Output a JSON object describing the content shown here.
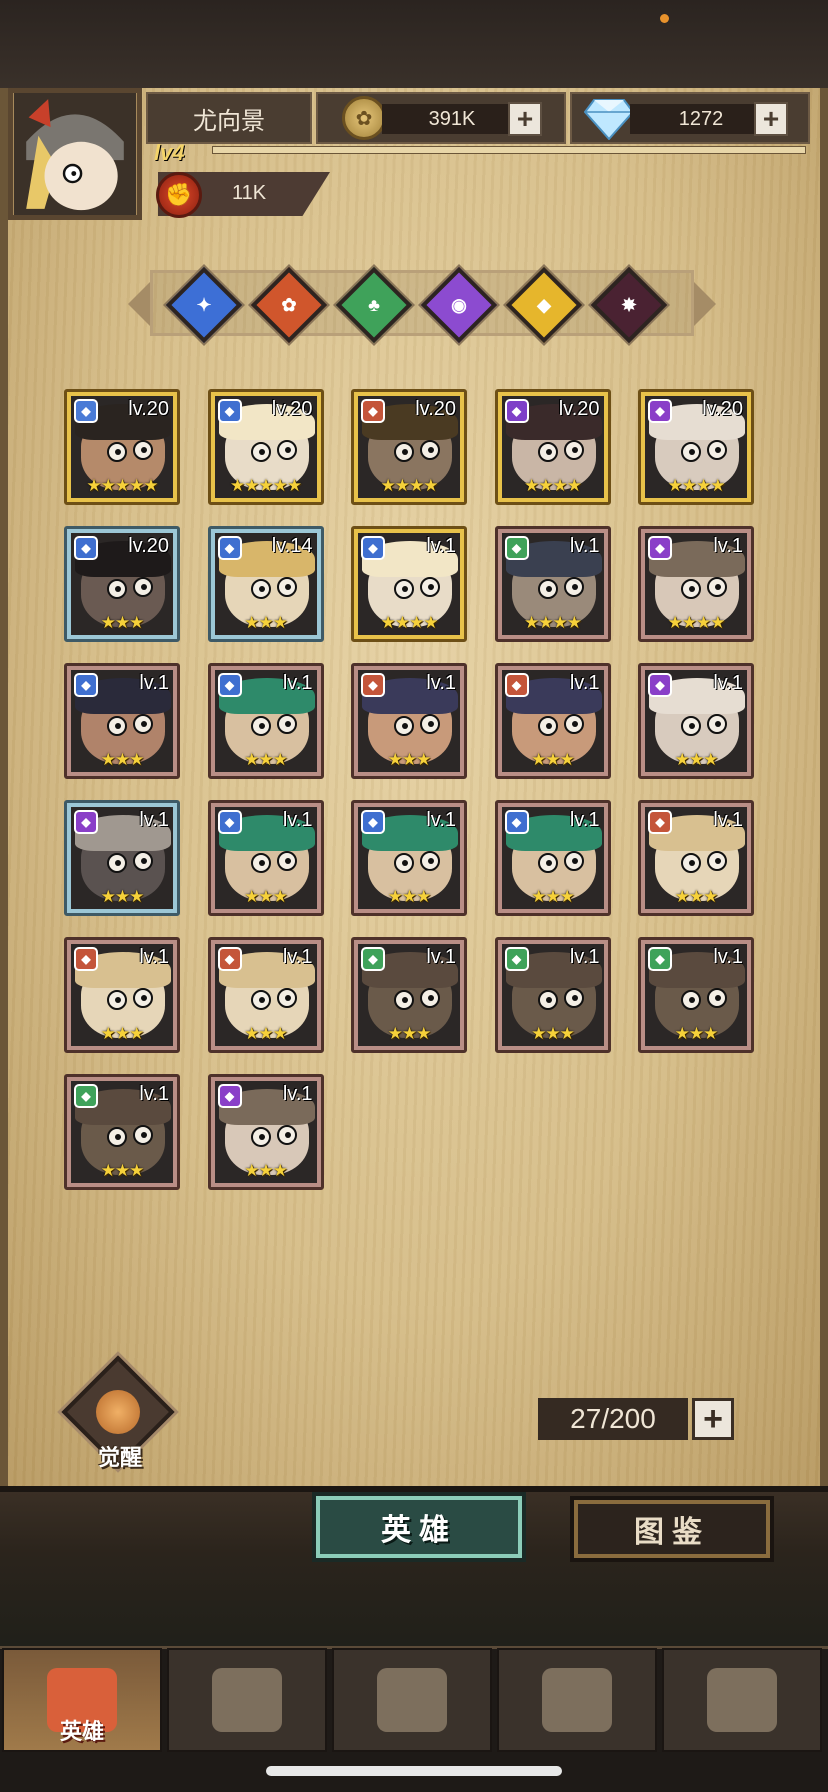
{
  "player": {
    "name": "尤向景",
    "level": "lv4",
    "power": "11K"
  },
  "resources": {
    "gold": "391K",
    "gems": "1272",
    "plus": "+"
  },
  "elements": [
    {
      "name": "blue-faction",
      "color": "#3d6fd6",
      "glyph": "✦"
    },
    {
      "name": "orange-faction",
      "color": "#d0562c",
      "glyph": "✿"
    },
    {
      "name": "green-faction",
      "color": "#3fa25a",
      "glyph": "♣"
    },
    {
      "name": "purple-faction",
      "color": "#8c4bd0",
      "glyph": "◉"
    },
    {
      "name": "gold-faction",
      "color": "#e6b62c",
      "glyph": "◆"
    },
    {
      "name": "dark-faction",
      "color": "#4a2232",
      "glyph": "✸"
    }
  ],
  "heroes": [
    {
      "lv": "lv.20",
      "stars": "★★★★★",
      "frame": "gold",
      "cls": "#4a7bd6",
      "skin": "#b58a6a",
      "hair": "#2a2420"
    },
    {
      "lv": "lv.20",
      "stars": "★★★★★",
      "frame": "gold",
      "cls": "#3f6fd0",
      "skin": "#e8dcc8",
      "hair": "#f2e6c6"
    },
    {
      "lv": "lv.20",
      "stars": "★★★★",
      "frame": "gold",
      "cls": "#c4553a",
      "skin": "#8a7560",
      "hair": "#4a3a22"
    },
    {
      "lv": "lv.20",
      "stars": "★★★★",
      "frame": "gold",
      "cls": "#7e3fc8",
      "skin": "#c9b6a6",
      "hair": "#3a2a2a"
    },
    {
      "lv": "lv.20",
      "stars": "★★★★",
      "frame": "gold",
      "cls": "#8a3fc8",
      "skin": "#d8cbbe",
      "hair": "#e6ddd2"
    },
    {
      "lv": "lv.20",
      "stars": "★★★",
      "frame": "blue",
      "cls": "#3f6fd0",
      "skin": "#6a5a52",
      "hair": "#1e1a1a"
    },
    {
      "lv": "lv.14",
      "stars": "★★★",
      "frame": "blue",
      "cls": "#3f6fd0",
      "skin": "#e6d6b8",
      "hair": "#d8b66a"
    },
    {
      "lv": "lv.1",
      "stars": "★★★★",
      "frame": "gold",
      "cls": "#3f6fd0",
      "skin": "#e8dcc8",
      "hair": "#f2e6c6"
    },
    {
      "lv": "lv.1",
      "stars": "★★★★",
      "frame": "brown",
      "cls": "#3fa25a",
      "skin": "#9a8a7a",
      "hair": "#3a4050"
    },
    {
      "lv": "lv.1",
      "stars": "★★★★",
      "frame": "brown",
      "cls": "#8a3fc8",
      "skin": "#d8c8b8",
      "hair": "#7a6a5a"
    },
    {
      "lv": "lv.1",
      "stars": "★★★",
      "frame": "brown",
      "cls": "#3f6fd0",
      "skin": "#b0836a",
      "hair": "#2a2a3a"
    },
    {
      "lv": "lv.1",
      "stars": "★★★",
      "frame": "brown",
      "cls": "#3f6fd0",
      "skin": "#d8c0a0",
      "hair": "#2e8a6a"
    },
    {
      "lv": "lv.1",
      "stars": "★★★",
      "frame": "brown",
      "cls": "#c4553a",
      "skin": "#c89a7a",
      "hair": "#3a3a5a"
    },
    {
      "lv": "lv.1",
      "stars": "★★★",
      "frame": "brown",
      "cls": "#c4553a",
      "skin": "#c89a7a",
      "hair": "#3a3a5a"
    },
    {
      "lv": "lv.1",
      "stars": "★★★",
      "frame": "brown",
      "cls": "#8a3fc8",
      "skin": "#d8cbbe",
      "hair": "#e6ddd2"
    },
    {
      "lv": "lv.1",
      "stars": "★★★",
      "frame": "blue",
      "cls": "#8a3fc8",
      "skin": "#5a5250",
      "hair": "#a09890"
    },
    {
      "lv": "lv.1",
      "stars": "★★★",
      "frame": "brown",
      "cls": "#3f6fd0",
      "skin": "#d8c0a0",
      "hair": "#2e8a6a"
    },
    {
      "lv": "lv.1",
      "stars": "★★★",
      "frame": "brown",
      "cls": "#3f6fd0",
      "skin": "#d8c0a0",
      "hair": "#2e8a6a"
    },
    {
      "lv": "lv.1",
      "stars": "★★★",
      "frame": "brown",
      "cls": "#3f6fd0",
      "skin": "#d8c0a0",
      "hair": "#2e8a6a"
    },
    {
      "lv": "lv.1",
      "stars": "★★★",
      "frame": "brown",
      "cls": "#c4553a",
      "skin": "#e6d6b8",
      "hair": "#d8c090"
    },
    {
      "lv": "lv.1",
      "stars": "★★★",
      "frame": "brown",
      "cls": "#c4553a",
      "skin": "#e6d6b8",
      "hair": "#d8c090"
    },
    {
      "lv": "lv.1",
      "stars": "★★★",
      "frame": "brown",
      "cls": "#c4553a",
      "skin": "#e6d6b8",
      "hair": "#d8c090"
    },
    {
      "lv": "lv.1",
      "stars": "★★★",
      "frame": "brown",
      "cls": "#3fa25a",
      "skin": "#6a5a4a",
      "hair": "#5a4a3e"
    },
    {
      "lv": "lv.1",
      "stars": "★★★",
      "frame": "brown",
      "cls": "#3fa25a",
      "skin": "#6a5a4a",
      "hair": "#5a4a3e"
    },
    {
      "lv": "lv.1",
      "stars": "★★★",
      "frame": "brown",
      "cls": "#3fa25a",
      "skin": "#6a5a4a",
      "hair": "#5a4a3e"
    },
    {
      "lv": "lv.1",
      "stars": "★★★",
      "frame": "brown",
      "cls": "#3fa25a",
      "skin": "#6a5a4a",
      "hair": "#5a4a3e"
    },
    {
      "lv": "lv.1",
      "stars": "★★★",
      "frame": "brown",
      "cls": "#8a3fc8",
      "skin": "#d8c8b8",
      "hair": "#7a6a5a"
    }
  ],
  "awaken_label": "觉醒",
  "capacity": "27/200",
  "tabs": {
    "heroes": "英雄",
    "codex": "图鉴"
  },
  "nav": [
    {
      "name": "nav-heroes",
      "label": "英雄",
      "active": true
    },
    {
      "name": "nav-adventure",
      "label": "",
      "active": false
    },
    {
      "name": "nav-battle",
      "label": "",
      "active": false
    },
    {
      "name": "nav-castle",
      "label": "",
      "active": false
    },
    {
      "name": "nav-guild",
      "label": "",
      "active": false
    }
  ]
}
